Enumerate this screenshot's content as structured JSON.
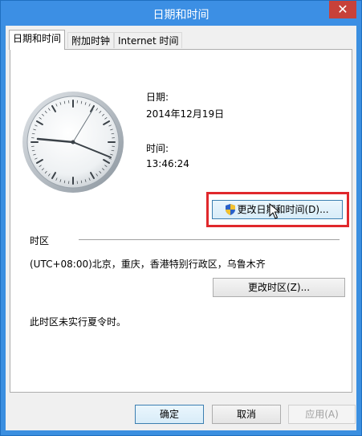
{
  "window": {
    "title": "日期和时间",
    "close_icon": "close-icon"
  },
  "tabs": [
    {
      "label": "日期和时间",
      "active": true
    },
    {
      "label": "附加时钟",
      "active": false
    },
    {
      "label": "Internet 时间",
      "active": false
    }
  ],
  "date": {
    "label": "日期:",
    "value": "2014年12月19日"
  },
  "time": {
    "label": "时间:",
    "value": "13:46:24"
  },
  "change_datetime_button": "更改日期和时间(D)...",
  "timezone": {
    "section_label": "时区",
    "value": "(UTC+08:00)北京，重庆，香港特别行政区，乌鲁木齐",
    "change_button": "更改时区(Z)...",
    "dst_note": "此时区未实行夏令时。"
  },
  "footer": {
    "ok": "确定",
    "cancel": "取消",
    "apply": "应用(A)"
  },
  "colors": {
    "title_bar": "#3c8fe4",
    "highlight_box": "#e0282c"
  }
}
